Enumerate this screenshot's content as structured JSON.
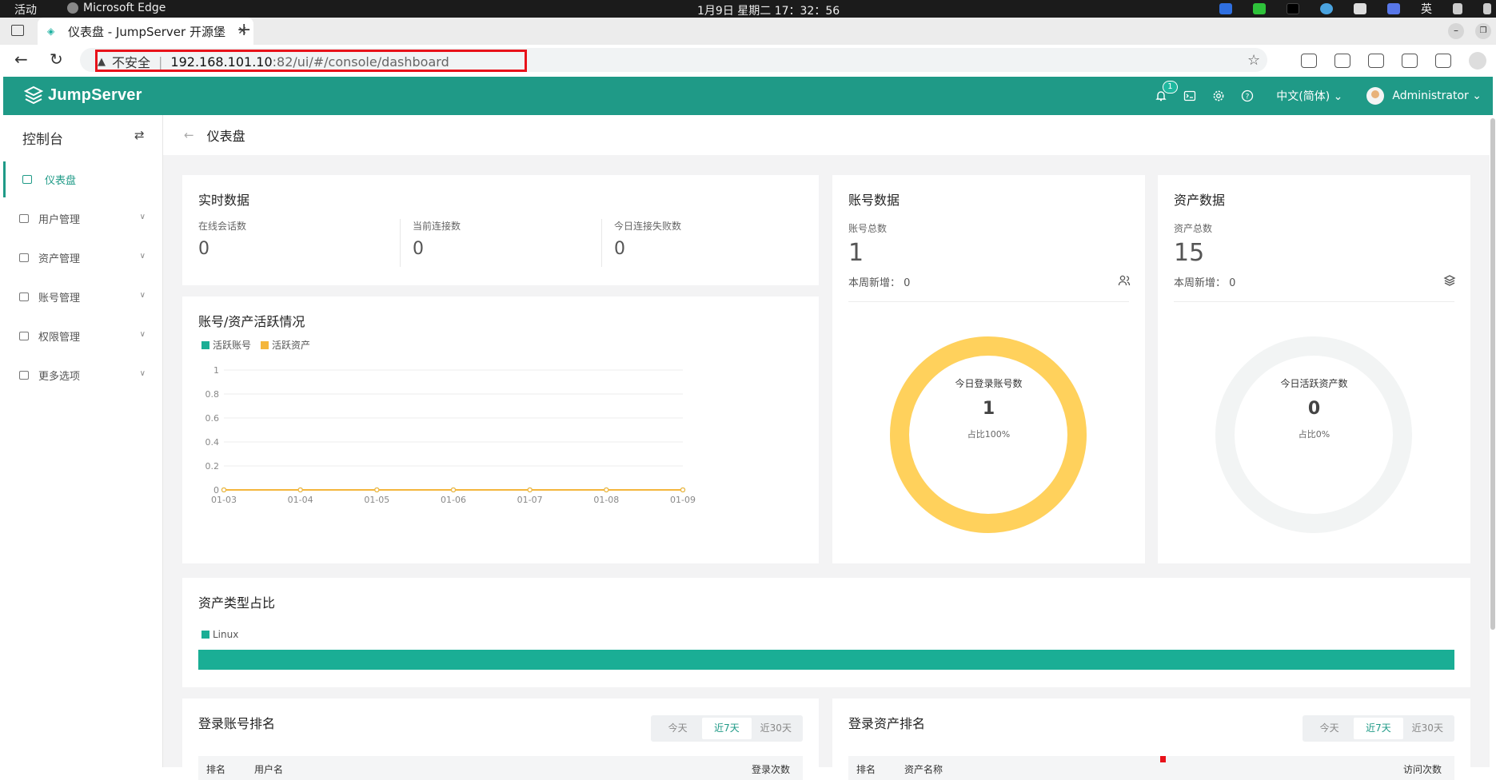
{
  "os": {
    "activities": "活动",
    "app_name": "Microsoft Edge",
    "clock": "1月9日 星期二  17：32：56",
    "ime": "英"
  },
  "browser": {
    "tab_title": "仪表盘 - JumpServer 开源堡",
    "url_warning": "不安全",
    "url_host": "192.168.101.10",
    "url_path": ":82/ui/#/console/dashboard"
  },
  "header": {
    "brand": "JumpServer",
    "notif_count": "1",
    "language": "中文(简体)",
    "user": "Administrator"
  },
  "sidebar": {
    "title": "控制台",
    "items": [
      {
        "label": "仪表盘",
        "active": true
      },
      {
        "label": "用户管理"
      },
      {
        "label": "资产管理"
      },
      {
        "label": "账号管理"
      },
      {
        "label": "权限管理"
      },
      {
        "label": "更多选项"
      }
    ]
  },
  "breadcrumb": {
    "title": "仪表盘"
  },
  "realtime": {
    "title": "实时数据",
    "stats": [
      {
        "label": "在线会话数",
        "value": "0"
      },
      {
        "label": "当前连接数",
        "value": "0"
      },
      {
        "label": "今日连接失败数",
        "value": "0"
      }
    ]
  },
  "account_data": {
    "title": "账号数据",
    "total_label": "账号总数",
    "total": "1",
    "new_label": "本周新增：",
    "new_value": "0",
    "ring_title": "今日登录账号数",
    "ring_value": "1",
    "ring_ratio": "占比100%",
    "percent": 100,
    "ring_color": "#ffd15c"
  },
  "asset_data": {
    "title": "资产数据",
    "total_label": "资产总数",
    "total": "15",
    "new_label": "本周新增：",
    "new_value": "0",
    "ring_title": "今日活跃资产数",
    "ring_value": "0",
    "ring_ratio": "占比0%",
    "percent": 0,
    "ring_color": "#f2f4f4"
  },
  "activity": {
    "title": "账号/资产活跃情况"
  },
  "chart_data": {
    "type": "line",
    "title": "账号/资产活跃情况",
    "categories": [
      "01-03",
      "01-04",
      "01-05",
      "01-06",
      "01-07",
      "01-08",
      "01-09"
    ],
    "yticks": [
      "0",
      "0.2",
      "0.4",
      "0.6",
      "0.8",
      "1"
    ],
    "ylim": [
      0,
      1
    ],
    "legend_position": "top-left",
    "grid": true,
    "series": [
      {
        "name": "活跃账号",
        "color": "#1aae95",
        "values": [
          0,
          0,
          0,
          0,
          0,
          0,
          0
        ]
      },
      {
        "name": "活跃资产",
        "color": "#f4b63c",
        "values": [
          0,
          0,
          0,
          0,
          0,
          0,
          0
        ]
      }
    ]
  },
  "asset_types": {
    "title": "资产类型占比",
    "items": [
      {
        "name": "Linux",
        "color": "#1aae95",
        "percent": 100
      }
    ]
  },
  "login_user_rank": {
    "title": "登录账号排名",
    "ranges": [
      "今天",
      "近7天",
      "近30天"
    ],
    "active": "近7天",
    "columns": [
      "排名",
      "用户名",
      "登录次数"
    ]
  },
  "login_asset_rank": {
    "title": "登录资产排名",
    "ranges": [
      "今天",
      "近7天",
      "近30天"
    ],
    "active": "近7天",
    "columns": [
      "排名",
      "资产名称",
      "访问次数"
    ]
  }
}
